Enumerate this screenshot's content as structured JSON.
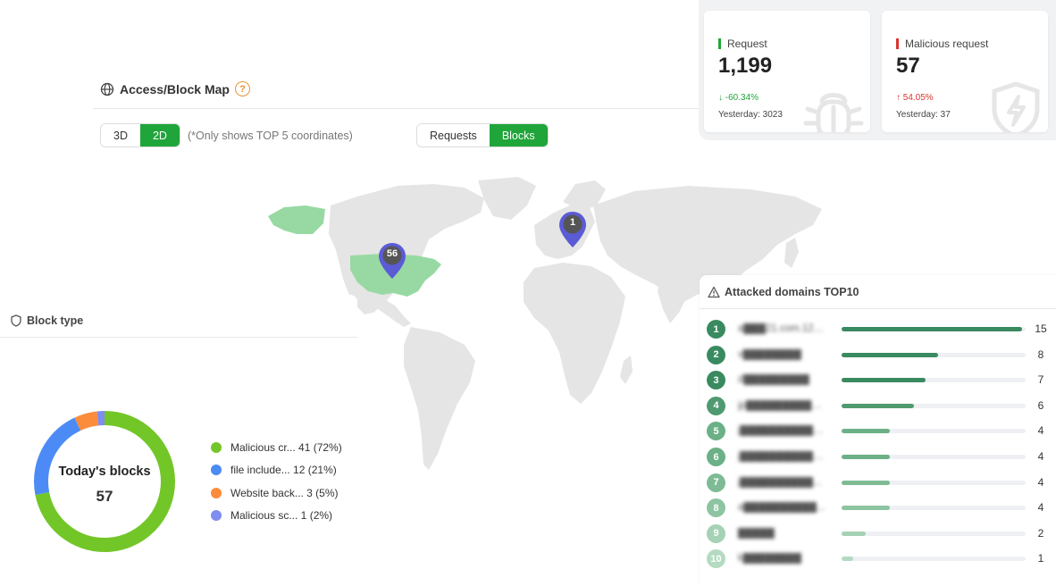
{
  "map": {
    "title": "Access/Block Map",
    "help": "?",
    "dimension_options": [
      "3D",
      "2D"
    ],
    "dimension_selected": "2D",
    "note": "(*Only shows TOP 5 coordinates)",
    "mode_options": [
      "Requests",
      "Blocks"
    ],
    "mode_selected": "Blocks",
    "pins": [
      {
        "region": "United States",
        "count": "56"
      },
      {
        "region": "Europe",
        "count": "1"
      }
    ],
    "colors": {
      "land": "#e5e5e5",
      "highlight": "#98d9a3",
      "pin": "#5b5bd6",
      "accent": "#20a53a"
    }
  },
  "stats": {
    "request": {
      "label": "Request",
      "value": "1,199",
      "change": "↓ -60.34%",
      "yesterday": "Yesterday: 3023",
      "bar_color": "#20a53a",
      "change_color": "#20a53a",
      "icon": "bug-icon"
    },
    "malicious": {
      "label": "Malicious request",
      "value": "57",
      "change": "↑ 54.05%",
      "yesterday": "Yesterday: 37",
      "bar_color": "#d9352f",
      "change_color": "#d9352f",
      "icon": "shield-bolt-icon"
    }
  },
  "block_type": {
    "title": "Block type",
    "center_title": "Today's blocks",
    "center_value": "57",
    "items": [
      {
        "label": "Malicious cr... 41 (72%)",
        "value": 41,
        "color": "#73c627"
      },
      {
        "label": "file include... 12 (21%)",
        "value": 12,
        "color": "#4c8bf5"
      },
      {
        "label": "Website back... 3 (5%)",
        "value": 3,
        "color": "#fb8c3c"
      },
      {
        "label": "Malicious sc... 1 (2%)",
        "value": 1,
        "color": "#7f8cf0"
      }
    ]
  },
  "domains": {
    "title": "Attacked domains TOP10",
    "max": 15,
    "items": [
      {
        "rank": "1",
        "name": "a███21.com.123.1...",
        "count": "15",
        "value": 15,
        "color": "#3a8a60"
      },
      {
        "rank": "2",
        "name": "v████████",
        "count": "8",
        "value": 8,
        "color": "#3a8a60"
      },
      {
        "rank": "3",
        "name": "d█████████",
        "count": "7",
        "value": 7,
        "color": "#3a8a60"
      },
      {
        "rank": "4",
        "name": "jp████████████...",
        "count": "6",
        "value": 6,
        "color": "#4f9a70"
      },
      {
        "rank": "5",
        "name": "j███████████...",
        "count": "4",
        "value": 4,
        "color": "#6cb087"
      },
      {
        "rank": "6",
        "name": "j████████████...",
        "count": "4",
        "value": 4,
        "color": "#6cb087"
      },
      {
        "rank": "7",
        "name": "j██████████...",
        "count": "4",
        "value": 4,
        "color": "#7ebb95"
      },
      {
        "rank": "8",
        "name": "a██████████...",
        "count": "4",
        "value": 4,
        "color": "#8dc4a1"
      },
      {
        "rank": "9",
        "name": "█████",
        "count": "2",
        "value": 2,
        "color": "#a5d2b4"
      },
      {
        "rank": "10",
        "name": "k████████",
        "count": "1",
        "value": 1,
        "color": "#b4dac1"
      }
    ]
  }
}
